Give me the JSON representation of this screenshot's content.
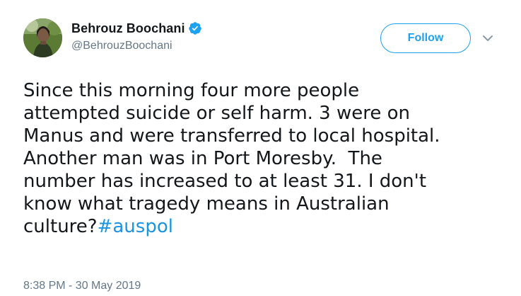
{
  "author": {
    "display_name": "Behrouz Boochani",
    "handle": "@BehrouzBoochani",
    "verified": true,
    "verified_icon": "verified-badge-icon",
    "avatar_icon": "profile-photo"
  },
  "actions": {
    "follow_label": "Follow",
    "menu_icon": "chevron-down-icon"
  },
  "tweet": {
    "body": "Since this morning four more people\nattempted suicide or self harm. 3 were on\nManus and were transferred to local hospital.\nAnother man was in Port Moresby.  The\nnumber has increased to at least 31. I don't\nknow what tragedy means in Australian\nculture?",
    "hashtag": "#auspol",
    "timestamp": "8:38 PM - 30 May 2019"
  },
  "colors": {
    "accent": "#1da1f2",
    "link": "#1b95e0",
    "text": "#14171a",
    "muted": "#657786"
  }
}
